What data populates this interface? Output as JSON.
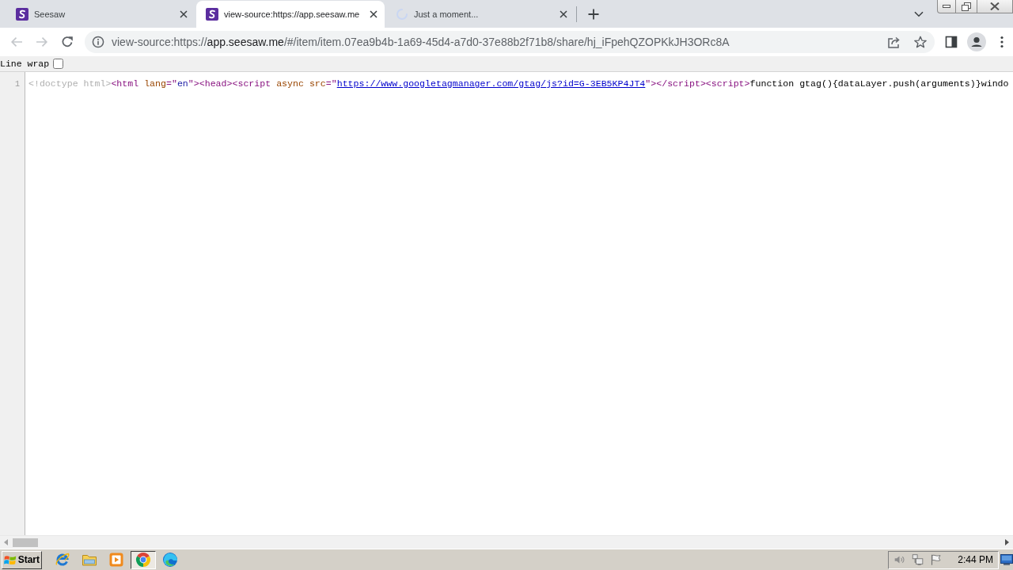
{
  "browser": {
    "tabs": [
      {
        "kind": "site",
        "title": "Seesaw",
        "selected": false
      },
      {
        "kind": "site",
        "title": "view-source:https://app.seesaw.me",
        "selected": true
      },
      {
        "kind": "loading",
        "title": "Just a moment...",
        "selected": false
      }
    ],
    "nav": [
      {
        "kind": "back",
        "disabled": true
      },
      {
        "kind": "forward",
        "disabled": true
      },
      {
        "kind": "reload",
        "disabled": false
      }
    ],
    "address": {
      "parts": [
        {
          "kind": "dim",
          "text": "view-source:https://"
        },
        {
          "kind": "host",
          "text": "app.seesaw.me"
        },
        {
          "kind": "dim",
          "text": "/#/item/item.07ea9b4b-1a69-45d4-a7d0-37e88b2f71b8/share/hj_iFpehQZOPKkJH3ORc8A"
        }
      ]
    }
  },
  "source_view": {
    "line_wrap": {
      "label": "Line wrap",
      "checked": false
    },
    "lines": [
      {
        "number": "1",
        "tokens": [
          {
            "kind": "doctype",
            "text": "<!doctype html>"
          },
          {
            "kind": "tag",
            "text": "<html "
          },
          {
            "kind": "attribute",
            "text": "lang"
          },
          {
            "kind": "tag",
            "text": "=\""
          },
          {
            "kind": "value",
            "text": "en"
          },
          {
            "kind": "tag",
            "text": "\"><head><script "
          },
          {
            "kind": "attribute",
            "text": "async src"
          },
          {
            "kind": "tag",
            "text": "=\""
          },
          {
            "kind": "link",
            "text": "https://www.googletagmanager.com/gtag/js?id=G-3EB5KP4JT4"
          },
          {
            "kind": "tag",
            "text": "\"></script><script>"
          },
          {
            "kind": "text",
            "text": "function gtag(){dataLayer.push(arguments)}windo"
          }
        ]
      }
    ]
  },
  "taskbar": {
    "start": "Start",
    "apps": [
      {
        "kind": "globe",
        "selected": false
      },
      {
        "kind": "folder",
        "selected": false
      },
      {
        "kind": "player",
        "selected": false
      },
      {
        "kind": "circle",
        "selected": true
      },
      {
        "kind": "wave",
        "selected": false
      }
    ],
    "clock": "2:44 PM"
  }
}
